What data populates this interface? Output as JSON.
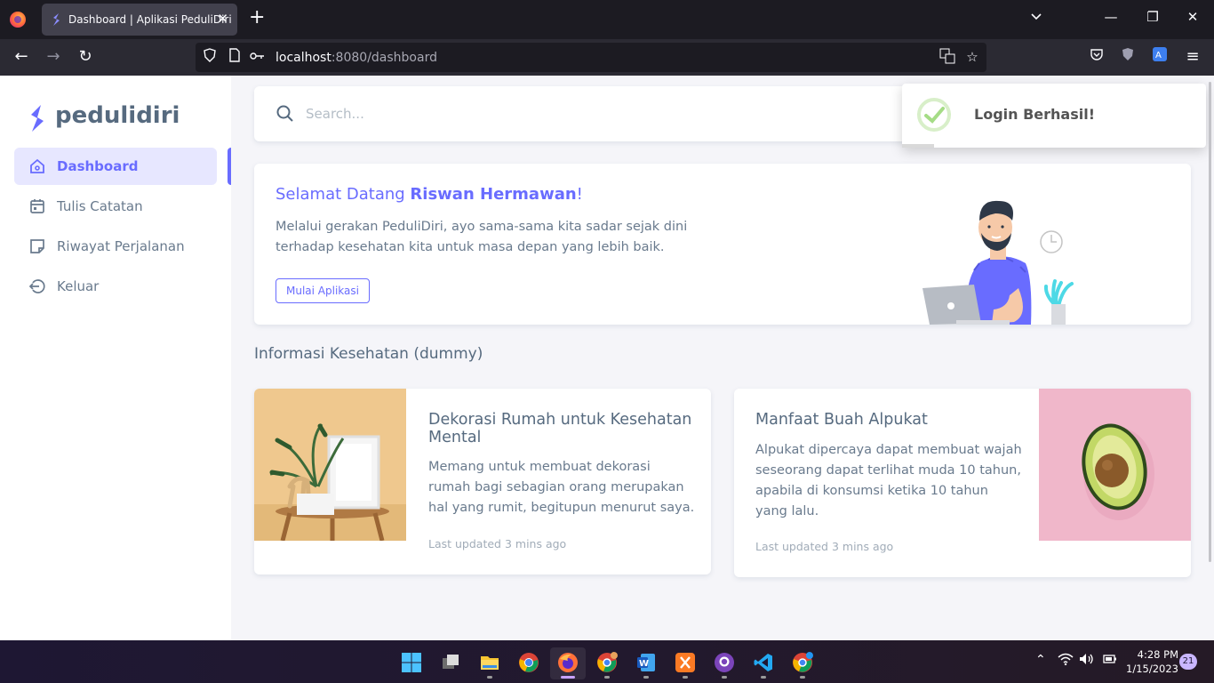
{
  "browser": {
    "tab_title": "Dashboard | Aplikasi PeduliDiri",
    "url_host": "localhost",
    "url_rest": ":8080/dashboard"
  },
  "app": {
    "brand": "pedulidiri",
    "accent": "#696cff",
    "menu": [
      {
        "label": "Dashboard",
        "icon": "home-icon",
        "active": true
      },
      {
        "label": "Tulis Catatan",
        "icon": "calendar-icon",
        "active": false
      },
      {
        "label": "Riwayat Perjalanan",
        "icon": "note-icon",
        "active": false
      },
      {
        "label": "Keluar",
        "icon": "logout-icon",
        "active": false
      }
    ],
    "search": {
      "placeholder": "Search..."
    },
    "toast": {
      "title": "Login Berhasil!",
      "status_color": "#a5dc86"
    },
    "welcome": {
      "greeting": "Selamat Datang ",
      "name": "Riswan Hermawan",
      "suffix": "!",
      "text": "Melalui gerakan PeduliDiri, ayo sama-sama kita sadar sejak dini terhadap kesehatan kita untuk masa depan yang lebih baik.",
      "button": "Mulai Aplikasi"
    },
    "section_title": "Informasi Kesehatan (dummy)",
    "cards": [
      {
        "title": "Dekorasi Rumah untuk Kesehatan Mental",
        "text": "Memang untuk membuat dekorasi rumah bagi sebagian orang merupakan hal yang rumit, begitupun menurut saya.",
        "meta": "Last updated 3 mins ago"
      },
      {
        "title": "Manfaat Buah Alpukat",
        "text": "Alpukat dipercaya dapat membuat wajah seseorang dapat terlihat muda 10 tahun, apabila di konsumsi ketika 10 tahun yang lalu.",
        "meta": "Last updated 3 mins ago"
      }
    ]
  },
  "taskbar": {
    "apps": [
      "start-icon",
      "task-view-icon",
      "file-explorer-icon",
      "chrome-icon",
      "firefox-icon",
      "chrome-profile-icon",
      "word-icon",
      "xampp-icon",
      "github-desktop-icon",
      "vscode-icon",
      "chrome-dev-icon"
    ],
    "time": "4:28 PM",
    "date": "1/15/2023",
    "notifications": "21"
  }
}
